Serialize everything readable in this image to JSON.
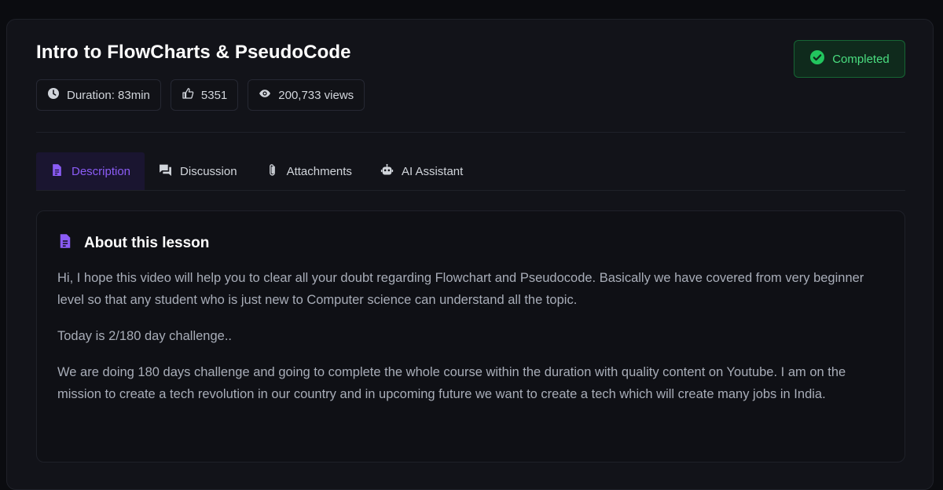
{
  "lesson": {
    "title": "Intro to FlowCharts & PseudoCode",
    "status": "Completed",
    "stats": {
      "duration": "Duration: 83min",
      "likes": "5351",
      "views": "200,733 views"
    }
  },
  "tabs": [
    {
      "label": "Description",
      "icon": "document-icon",
      "active": true
    },
    {
      "label": "Discussion",
      "icon": "chat-icon",
      "active": false
    },
    {
      "label": "Attachments",
      "icon": "paperclip-icon",
      "active": false
    },
    {
      "label": "AI Assistant",
      "icon": "robot-icon",
      "active": false
    }
  ],
  "description": {
    "heading": "About this lesson",
    "paragraphs": [
      "Hi, I hope this video will help you to clear all your doubt regarding Flowchart and Pseudocode. Basically we have covered from very beginner level so that any student who is just new to Computer science can understand all the topic.",
      "Today is 2/180 day challenge..",
      "We are doing 180 days challenge and going to complete the whole course within the duration with quality content on Youtube. I am on the mission to create a tech revolution in our country and in upcoming future we want to create a tech which will create many jobs in India."
    ]
  },
  "colors": {
    "accent": "#8b5cf6",
    "success": "#4ade80",
    "background": "#0b0c10",
    "card": "#121319"
  }
}
